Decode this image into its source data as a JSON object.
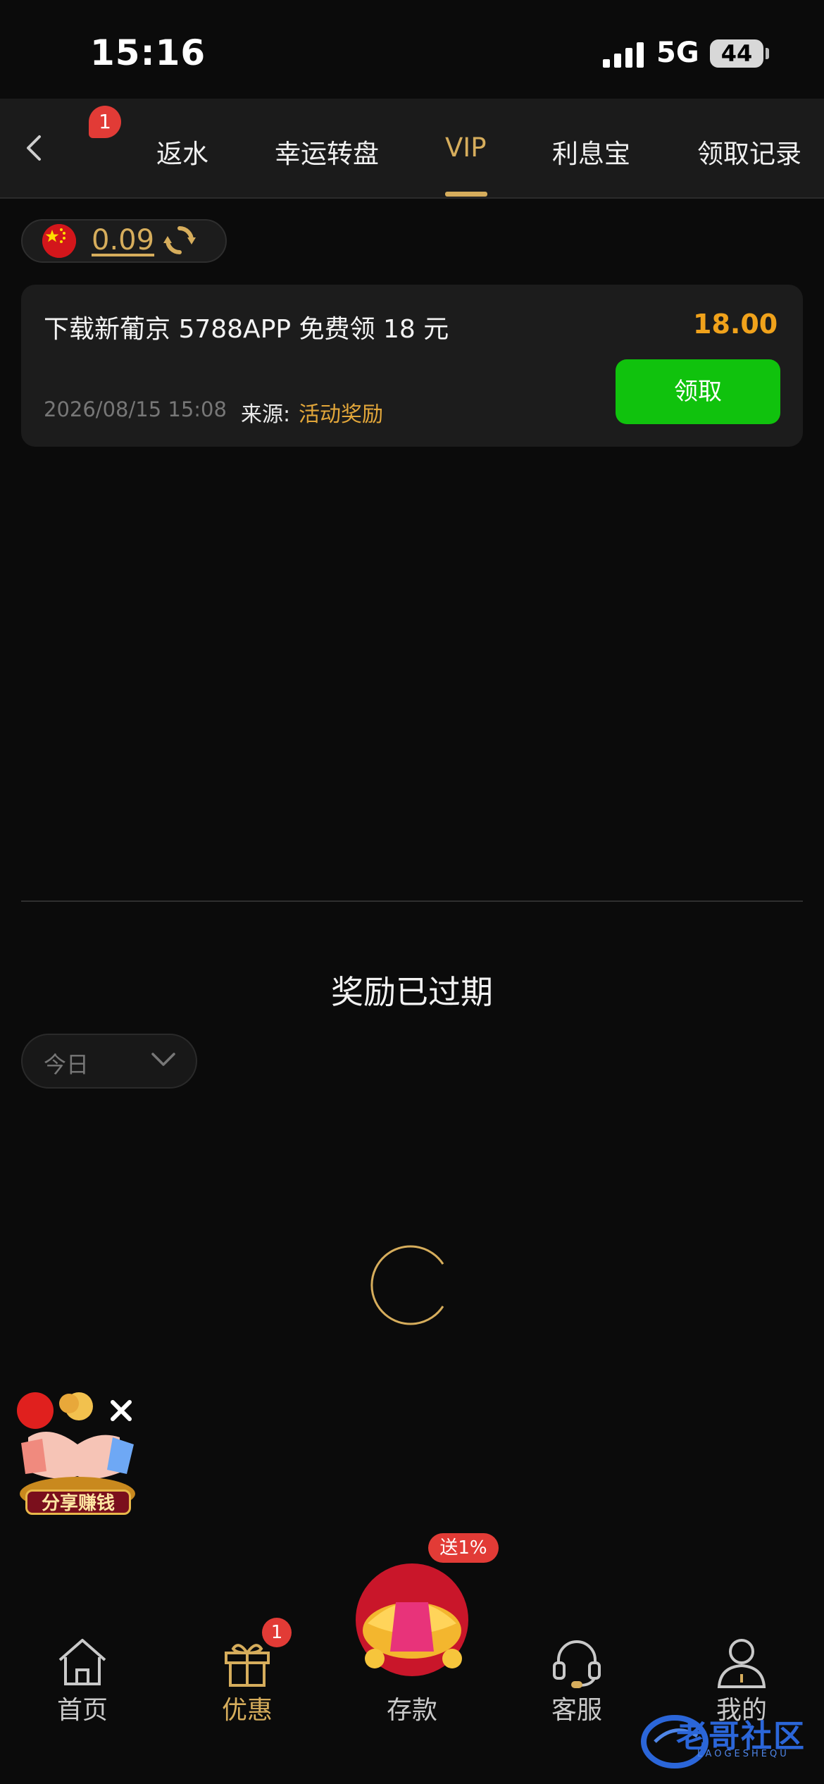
{
  "status_bar": {
    "time": "15:16",
    "network": "5G",
    "battery": "44"
  },
  "tabs": [
    {
      "label": "返水"
    },
    {
      "label": "幸运转盘"
    },
    {
      "label": "VIP",
      "active": true
    },
    {
      "label": "利息宝"
    },
    {
      "label": "领取记录"
    }
  ],
  "notification_count": "1",
  "balance": {
    "amount": "0.09",
    "currency_flag": "china-flag-icon"
  },
  "reward": {
    "title": "下载新葡京 5788APP 免费领 18 元",
    "amount": "18.00",
    "time": "2026/08/15 15:08",
    "source_label": "来源:",
    "source_value": "活动奖励",
    "claim_label": "领取"
  },
  "expired_text": "奖励已过期",
  "date_filter": {
    "selected": "今日"
  },
  "share_promo": {
    "label": "分享赚钱"
  },
  "bottom_nav": {
    "items": [
      {
        "label": "首页",
        "icon": "home-icon"
      },
      {
        "label": "优惠",
        "icon": "gift-icon",
        "active": true,
        "badge": "1"
      },
      {
        "label": "存款",
        "icon": "deposit-ingot-icon"
      },
      {
        "label": "客服",
        "icon": "headset-icon"
      },
      {
        "label": "我的",
        "icon": "user-icon"
      }
    ],
    "deposit_badge": "送1%"
  },
  "watermark": {
    "text": "老哥社区",
    "sub": "LAOGESHEQU"
  },
  "colors": {
    "accent": "#d6ad5c",
    "claim_button": "#10c20d",
    "badge": "#e23b36",
    "amount": "#f0a21b"
  }
}
